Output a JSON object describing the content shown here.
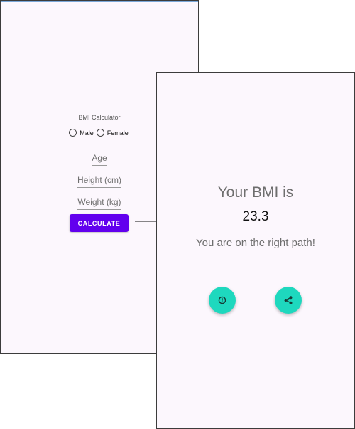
{
  "input_screen": {
    "title": "BMI Calculator",
    "gender": {
      "options": [
        "Male",
        "Female"
      ]
    },
    "fields": {
      "age_hint": "Age",
      "height_hint": "Height (cm)",
      "weight_hint": "Weight (kg)"
    },
    "calculate_label": "CALCULATE"
  },
  "result_screen": {
    "heading": "Your BMI is",
    "bmi_value": "23.3",
    "message": "You are on the right path!",
    "actions": {
      "info_icon": "info-icon",
      "share_icon": "share-icon"
    }
  },
  "colors": {
    "screen_background": "#fcf7fd",
    "primary_button": "#6200ee",
    "fab": "#1ed8be",
    "status_line": "#7aa7d8"
  }
}
